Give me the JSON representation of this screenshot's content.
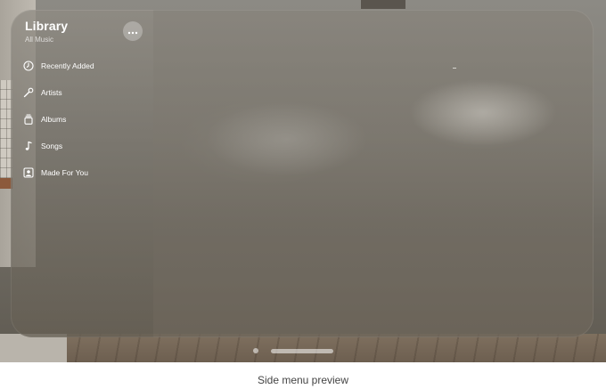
{
  "sidebar": {
    "title": "Library",
    "subtitle": "All Music",
    "more_icon": "ellipsis-icon",
    "items": [
      {
        "label": "Recently Added",
        "icon": "clock-icon"
      },
      {
        "label": "Artists",
        "icon": "microphone-icon"
      },
      {
        "label": "Albums",
        "icon": "album-stack-icon"
      },
      {
        "label": "Songs",
        "icon": "music-note-icon"
      },
      {
        "label": "Made For You",
        "icon": "person-square-icon"
      }
    ]
  },
  "caption": "Side menu preview"
}
